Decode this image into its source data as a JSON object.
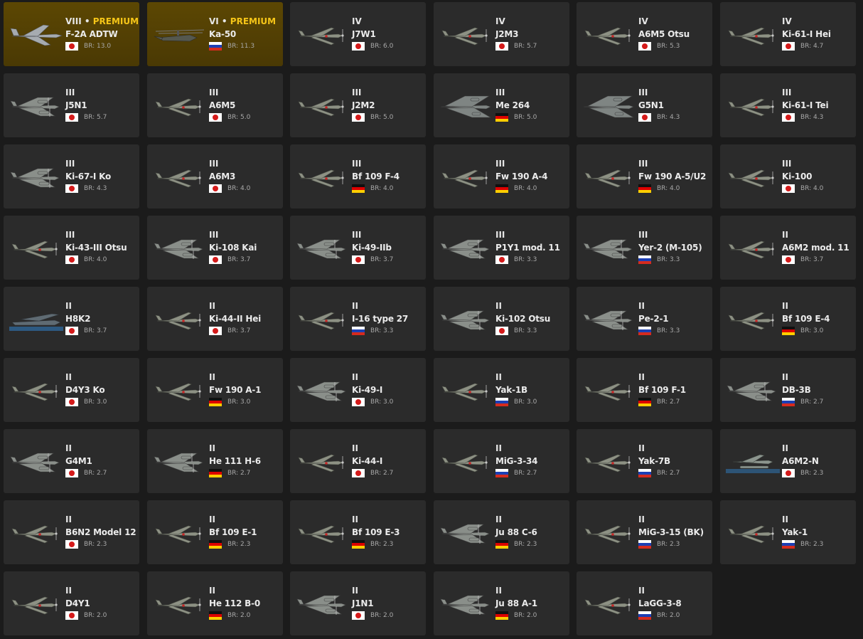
{
  "colors": {
    "background": "#1b1b1b",
    "card": "#2b2b2b",
    "premium_card": "#5c4703",
    "premium_text": "#f5c518"
  },
  "vehicles": [
    {
      "rank": "VIII •",
      "premium": "PREMIUM",
      "name": "F-2A ADTW",
      "nation": "jp",
      "br": "BR: 13.0",
      "kind": "jet"
    },
    {
      "rank": "VI •",
      "premium": "PREMIUM",
      "name": "Ka-50",
      "nation": "ru",
      "br": "BR: 11.3",
      "kind": "heli"
    },
    {
      "rank": "IV",
      "premium": "",
      "name": "J7W1",
      "nation": "jp",
      "br": "BR: 6.0",
      "kind": "fighter"
    },
    {
      "rank": "IV",
      "premium": "",
      "name": "J2M3",
      "nation": "jp",
      "br": "BR: 5.7",
      "kind": "fighter"
    },
    {
      "rank": "IV",
      "premium": "",
      "name": "A6M5 Otsu",
      "nation": "jp",
      "br": "BR: 5.3",
      "kind": "fighter"
    },
    {
      "rank": "IV",
      "premium": "",
      "name": "Ki-61-I Hei",
      "nation": "jp",
      "br": "BR: 4.7",
      "kind": "fighter"
    },
    {
      "rank": "III",
      "premium": "",
      "name": "J5N1",
      "nation": "jp",
      "br": "BR: 5.7",
      "kind": "twin"
    },
    {
      "rank": "III",
      "premium": "",
      "name": "A6M5",
      "nation": "jp",
      "br": "BR: 5.0",
      "kind": "fighter"
    },
    {
      "rank": "III",
      "premium": "",
      "name": "J2M2",
      "nation": "jp",
      "br": "BR: 5.0",
      "kind": "fighter"
    },
    {
      "rank": "III",
      "premium": "",
      "name": "Me 264",
      "nation": "de",
      "br": "BR: 5.0",
      "kind": "bomber"
    },
    {
      "rank": "III",
      "premium": "",
      "name": "G5N1",
      "nation": "jp",
      "br": "BR: 4.3",
      "kind": "bomber"
    },
    {
      "rank": "III",
      "premium": "",
      "name": "Ki-61-I Tei",
      "nation": "jp",
      "br": "BR: 4.3",
      "kind": "fighter"
    },
    {
      "rank": "III",
      "premium": "",
      "name": "Ki-67-I Ko",
      "nation": "jp",
      "br": "BR: 4.3",
      "kind": "twin"
    },
    {
      "rank": "III",
      "premium": "",
      "name": "A6M3",
      "nation": "jp",
      "br": "BR: 4.0",
      "kind": "fighter"
    },
    {
      "rank": "III",
      "premium": "",
      "name": "Bf 109 F-4",
      "nation": "de",
      "br": "BR: 4.0",
      "kind": "fighter"
    },
    {
      "rank": "III",
      "premium": "",
      "name": "Fw 190 A-4",
      "nation": "de",
      "br": "BR: 4.0",
      "kind": "fighter"
    },
    {
      "rank": "III",
      "premium": "",
      "name": "Fw 190 A-5/U2",
      "nation": "de",
      "br": "BR: 4.0",
      "kind": "fighter"
    },
    {
      "rank": "III",
      "premium": "",
      "name": "Ki-100",
      "nation": "jp",
      "br": "BR: 4.0",
      "kind": "fighter"
    },
    {
      "rank": "III",
      "premium": "",
      "name": "Ki-43-III Otsu",
      "nation": "jp",
      "br": "BR: 4.0",
      "kind": "fighter"
    },
    {
      "rank": "III",
      "premium": "",
      "name": "Ki-108 Kai",
      "nation": "jp",
      "br": "BR: 3.7",
      "kind": "twin"
    },
    {
      "rank": "III",
      "premium": "",
      "name": "Ki-49-IIb",
      "nation": "jp",
      "br": "BR: 3.7",
      "kind": "twin"
    },
    {
      "rank": "III",
      "premium": "",
      "name": "P1Y1 mod. 11",
      "nation": "jp",
      "br": "BR: 3.3",
      "kind": "twin"
    },
    {
      "rank": "III",
      "premium": "",
      "name": "Yer-2 (M-105)",
      "nation": "ru",
      "br": "BR: 3.3",
      "kind": "twin"
    },
    {
      "rank": "II",
      "premium": "",
      "name": "A6M2 mod. 11",
      "nation": "jp",
      "br": "BR: 3.7",
      "kind": "fighter"
    },
    {
      "rank": "II",
      "premium": "",
      "name": "H8K2",
      "nation": "jp",
      "br": "BR: 3.7",
      "kind": "flyingboat"
    },
    {
      "rank": "II",
      "premium": "",
      "name": "Ki-44-II Hei",
      "nation": "jp",
      "br": "BR: 3.7",
      "kind": "fighter"
    },
    {
      "rank": "II",
      "premium": "",
      "name": "I-16 type 27",
      "nation": "ru",
      "br": "BR: 3.3",
      "kind": "fighter"
    },
    {
      "rank": "II",
      "premium": "",
      "name": "Ki-102 Otsu",
      "nation": "jp",
      "br": "BR: 3.3",
      "kind": "twin"
    },
    {
      "rank": "II",
      "premium": "",
      "name": "Pe-2-1",
      "nation": "ru",
      "br": "BR: 3.3",
      "kind": "twin"
    },
    {
      "rank": "II",
      "premium": "",
      "name": "Bf 109 E-4",
      "nation": "de",
      "br": "BR: 3.0",
      "kind": "fighter"
    },
    {
      "rank": "II",
      "premium": "",
      "name": "D4Y3 Ko",
      "nation": "jp",
      "br": "BR: 3.0",
      "kind": "fighter"
    },
    {
      "rank": "II",
      "premium": "",
      "name": "Fw 190 A-1",
      "nation": "de",
      "br": "BR: 3.0",
      "kind": "fighter"
    },
    {
      "rank": "II",
      "premium": "",
      "name": "Ki-49-I",
      "nation": "jp",
      "br": "BR: 3.0",
      "kind": "twin"
    },
    {
      "rank": "II",
      "premium": "",
      "name": "Yak-1B",
      "nation": "ru",
      "br": "BR: 3.0",
      "kind": "fighter"
    },
    {
      "rank": "II",
      "premium": "",
      "name": "Bf 109 F-1",
      "nation": "de",
      "br": "BR: 2.7",
      "kind": "fighter"
    },
    {
      "rank": "II",
      "premium": "",
      "name": "DB-3B",
      "nation": "ru",
      "br": "BR: 2.7",
      "kind": "twin"
    },
    {
      "rank": "II",
      "premium": "",
      "name": "G4M1",
      "nation": "jp",
      "br": "BR: 2.7",
      "kind": "twin"
    },
    {
      "rank": "II",
      "premium": "",
      "name": "He 111 H-6",
      "nation": "de",
      "br": "BR: 2.7",
      "kind": "twin"
    },
    {
      "rank": "II",
      "premium": "",
      "name": "Ki-44-I",
      "nation": "jp",
      "br": "BR: 2.7",
      "kind": "fighter"
    },
    {
      "rank": "II",
      "premium": "",
      "name": "MiG-3-34",
      "nation": "ru",
      "br": "BR: 2.7",
      "kind": "fighter"
    },
    {
      "rank": "II",
      "premium": "",
      "name": "Yak-7B",
      "nation": "ru",
      "br": "BR: 2.7",
      "kind": "fighter"
    },
    {
      "rank": "II",
      "premium": "",
      "name": "A6M2-N",
      "nation": "jp",
      "br": "BR: 2.3",
      "kind": "floatplane"
    },
    {
      "rank": "II",
      "premium": "",
      "name": "B6N2 Model 12",
      "nation": "jp",
      "br": "BR: 2.3",
      "kind": "fighter"
    },
    {
      "rank": "II",
      "premium": "",
      "name": "Bf 109 E-1",
      "nation": "de",
      "br": "BR: 2.3",
      "kind": "fighter"
    },
    {
      "rank": "II",
      "premium": "",
      "name": "Bf 109 E-3",
      "nation": "de",
      "br": "BR: 2.3",
      "kind": "fighter"
    },
    {
      "rank": "II",
      "premium": "",
      "name": "Ju 88 C-6",
      "nation": "de",
      "br": "BR: 2.3",
      "kind": "twin"
    },
    {
      "rank": "II",
      "premium": "",
      "name": "MiG-3-15 (BK)",
      "nation": "ru",
      "br": "BR: 2.3",
      "kind": "fighter"
    },
    {
      "rank": "II",
      "premium": "",
      "name": "Yak-1",
      "nation": "ru",
      "br": "BR: 2.3",
      "kind": "fighter"
    },
    {
      "rank": "II",
      "premium": "",
      "name": "D4Y1",
      "nation": "jp",
      "br": "BR: 2.0",
      "kind": "fighter"
    },
    {
      "rank": "II",
      "premium": "",
      "name": "He 112 B-0",
      "nation": "de",
      "br": "BR: 2.0",
      "kind": "fighter"
    },
    {
      "rank": "II",
      "premium": "",
      "name": "J1N1",
      "nation": "jp",
      "br": "BR: 2.0",
      "kind": "twin"
    },
    {
      "rank": "II",
      "premium": "",
      "name": "Ju 88 A-1",
      "nation": "de",
      "br": "BR: 2.0",
      "kind": "twin"
    },
    {
      "rank": "II",
      "premium": "",
      "name": "LaGG-3-8",
      "nation": "ru",
      "br": "BR: 2.0",
      "kind": "fighter"
    }
  ]
}
